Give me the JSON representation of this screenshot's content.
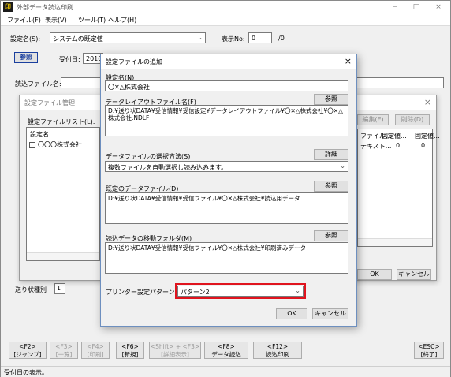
{
  "window": {
    "app_icon_glyph": "印",
    "title": "外部データ読込印刷",
    "controls": {
      "minimize": "−",
      "maximize": "□",
      "close": "×"
    }
  },
  "menu": [
    "ファイル(F)",
    "表示(V)",
    "ツール(T)",
    "ヘルプ(H)"
  ],
  "main": {
    "setting_name_label": "設定名(S):",
    "setting_name_value": "システムの既定値",
    "display_no_label": "表示No:",
    "display_no_value": "0",
    "display_no_total": "/0",
    "browse_button": "参照",
    "receive_date_label": "受付日:",
    "receive_date_value": "2016",
    "read_file_label": "読込ファイル名:",
    "partial_label": "送り状種別",
    "partial_value": "1"
  },
  "manager_dialog": {
    "title": "設定ファイル管理",
    "list_label": "設定ファイルリスト(L):",
    "col_setting_name": "設定名",
    "rows": [
      "〇〇〇株式会社"
    ],
    "right_buttons": [
      "編集(E)",
      "削除(D)"
    ],
    "right_cols": [
      "ファイル...",
      "固定値...",
      "固定値..."
    ],
    "right_row": [
      "テキスト...",
      "0",
      "0"
    ],
    "ok_button": "OK",
    "cancel_button": "キャンセル"
  },
  "add_dialog": {
    "title": "設定ファイルの追加",
    "setting_name_label": "設定名(N)",
    "setting_name_value": "〇✕△株式会社",
    "layout_label": "データレイアウトファイル名(F)",
    "layout_value": "D:¥送り状DATA¥受信情報¥受信設定¥データレイアウトファイル¥〇✕△株式会社¥〇✕△株式会社.NDLF",
    "select_method_label": "データファイルの選択方法(S)",
    "select_method_value": "複数ファイルを自動選択し読み込みます。",
    "detail_button": "詳細",
    "default_file_label": "既定のデータファイル(D)",
    "default_file_value": "D:¥送り状DATA¥受信情報¥受信ファイル¥〇✕△株式会社¥読込用データ",
    "move_folder_label": "読込データの移動フォルダ(M)",
    "move_folder_value": "D:¥送り状DATA¥受信情報¥受信ファイル¥〇✕△株式会社¥印刷済みデータ",
    "browse_button": "参照",
    "printer_pattern_label": "プリンター設定パターン(P):",
    "printer_pattern_value": "パターン2",
    "ok_button": "OK",
    "cancel_button": "キャンセル"
  },
  "fkeys": [
    {
      "key": "<F2>",
      "label": "[ジャンプ]",
      "enabled": true
    },
    {
      "key": "<F3>",
      "label": "[一覧]",
      "enabled": false
    },
    {
      "key": "<F4>",
      "label": "[印刷]",
      "enabled": false
    },
    {
      "key": "<F6>",
      "label": "[新規]",
      "enabled": true
    },
    {
      "key": "<Shift> + <F3>",
      "label": "[詳細表示]",
      "enabled": false
    },
    {
      "key": "<F8>",
      "label": "データ読込",
      "enabled": true
    },
    {
      "key": "<F12>",
      "label": "読込印刷",
      "enabled": true
    },
    {
      "key": "<ESC>",
      "label": "[終了]",
      "enabled": true
    }
  ],
  "status_text": "受付日の表示。",
  "colors": {
    "highlight": "#e0141e",
    "browse_blue": "#1a3f9e"
  }
}
